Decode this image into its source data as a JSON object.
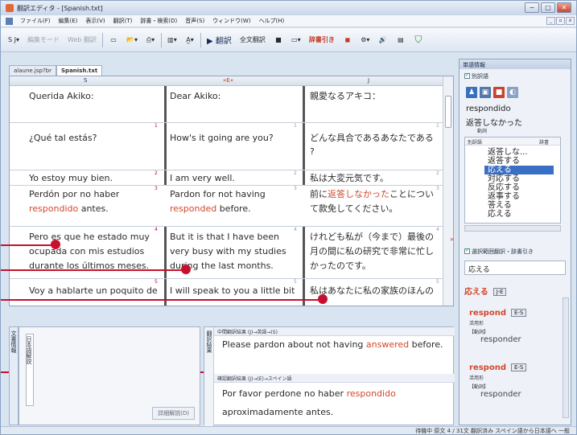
{
  "window": {
    "title": "翻訳エディタ - [Spanish.txt]",
    "controls": [
      "−",
      "□",
      "✕"
    ],
    "mdi_controls": [
      "_",
      "▫",
      "x"
    ]
  },
  "menu": [
    "ファイル(F)",
    "編集(E)",
    "表示(V)",
    "翻訳(T)",
    "辞書・検索(D)",
    "音声(S)",
    "ウィンドウ(W)",
    "ヘルプ(H)"
  ],
  "toolbar": {
    "lang_selector": "S J▾",
    "pause": "編集モード",
    "web": "Web 翻訳",
    "translate": "▶ 翻訳",
    "translate_all": "全文翻訳",
    "stop": "■",
    "dictionary": "辞書引き"
  },
  "tabs": {
    "tab1": "alaune.jsp?br",
    "tab2": "Spanish.txt"
  },
  "columns": {
    "source": "S",
    "middle": "»E«",
    "target": "J"
  },
  "rows": [
    {
      "num": "",
      "s": "Querida Akiko:",
      "e": "Dear Akiko:",
      "j": "親愛なるアキコ："
    },
    {
      "num": "1",
      "s": "¿Qué tal estás?",
      "e": "How's it going are you?",
      "j": "どんな具合であるあなたである"
    },
    {
      "num": "",
      "s": "",
      "e": "",
      "j": "?"
    },
    {
      "num": "2",
      "s": "Yo estoy muy bien.",
      "e": "I am very well.",
      "j": "私は大変元気です。"
    },
    {
      "num": "3",
      "s": "Perdón por no haber",
      "e": "Pardon for not having",
      "j_pre": "前に",
      "j_hl": "返答しなかった",
      "j_post": "ことについ"
    },
    {
      "num": "",
      "s_hl": "respondido",
      "s_post": " antes.",
      "e_hl": "responded",
      "e_post": " before.",
      "j": "て款免してください。"
    },
    {
      "num": "4",
      "s": "Pero es que he estado muy",
      "e": "But it is that I have been",
      "j": "けれども私が（今まで）最後の"
    },
    {
      "num": "",
      "s": "ocupada con mis estudios",
      "e": "very busy with my studies",
      "j": "月の間に私の研究で非常に忙し"
    },
    {
      "num": "",
      "s": "durante los últimos meses.",
      "e": "during the last months.",
      "j": "かったのです。"
    },
    {
      "num": "5",
      "s": "Voy a hablarte un poquito de",
      "e": "I will speak to you a little bit",
      "j": "私はあなたに私の家族のほんの"
    }
  ],
  "bottom": {
    "side_label": "文書情報",
    "left_vlabel": "日本語解説",
    "left_button": "詳細解説(D)",
    "right_label": "翻訳結果",
    "head1": "中間翻訳結果 (J)→英語→(S)",
    "line1_pre": "Please pardon about not having ",
    "line1_hl": "answered",
    "line1_post": " before.",
    "head2": "確認翻訳結果 (J)→(E)→スペイン語",
    "line2_pre": "Por favor perdone no haber ",
    "line2_hl": "respondido",
    "line3": "aproximadamente antes."
  },
  "status": "待機中  原文  4 / 31文  翻訳済み  スペイン語から日本語へ  一般",
  "panel": {
    "title": "単語情報",
    "check1": "別訳語",
    "word": "respondido",
    "meaning": "返答しなかった",
    "pos": "動詞",
    "list_head_left": "別訳語",
    "list_head_right": "辞書",
    "list": [
      "返答しな...",
      "返答する",
      "応える",
      "対応する",
      "反応する",
      "返事する",
      "答える",
      "応える"
    ],
    "check2": "選択範囲翻訳・辞書引き",
    "input_value": "応える",
    "entry_head": "応える",
    "entry_tag": "J-E",
    "entries": [
      {
        "word": "respond",
        "tag": "E-S",
        "pos1": "活用形",
        "pos2": "【動詞】",
        "trans": "responder"
      },
      {
        "word": "respond",
        "tag": "E-S",
        "pos1": "活用形",
        "pos2": "【動詞】",
        "trans": "responder"
      }
    ]
  }
}
